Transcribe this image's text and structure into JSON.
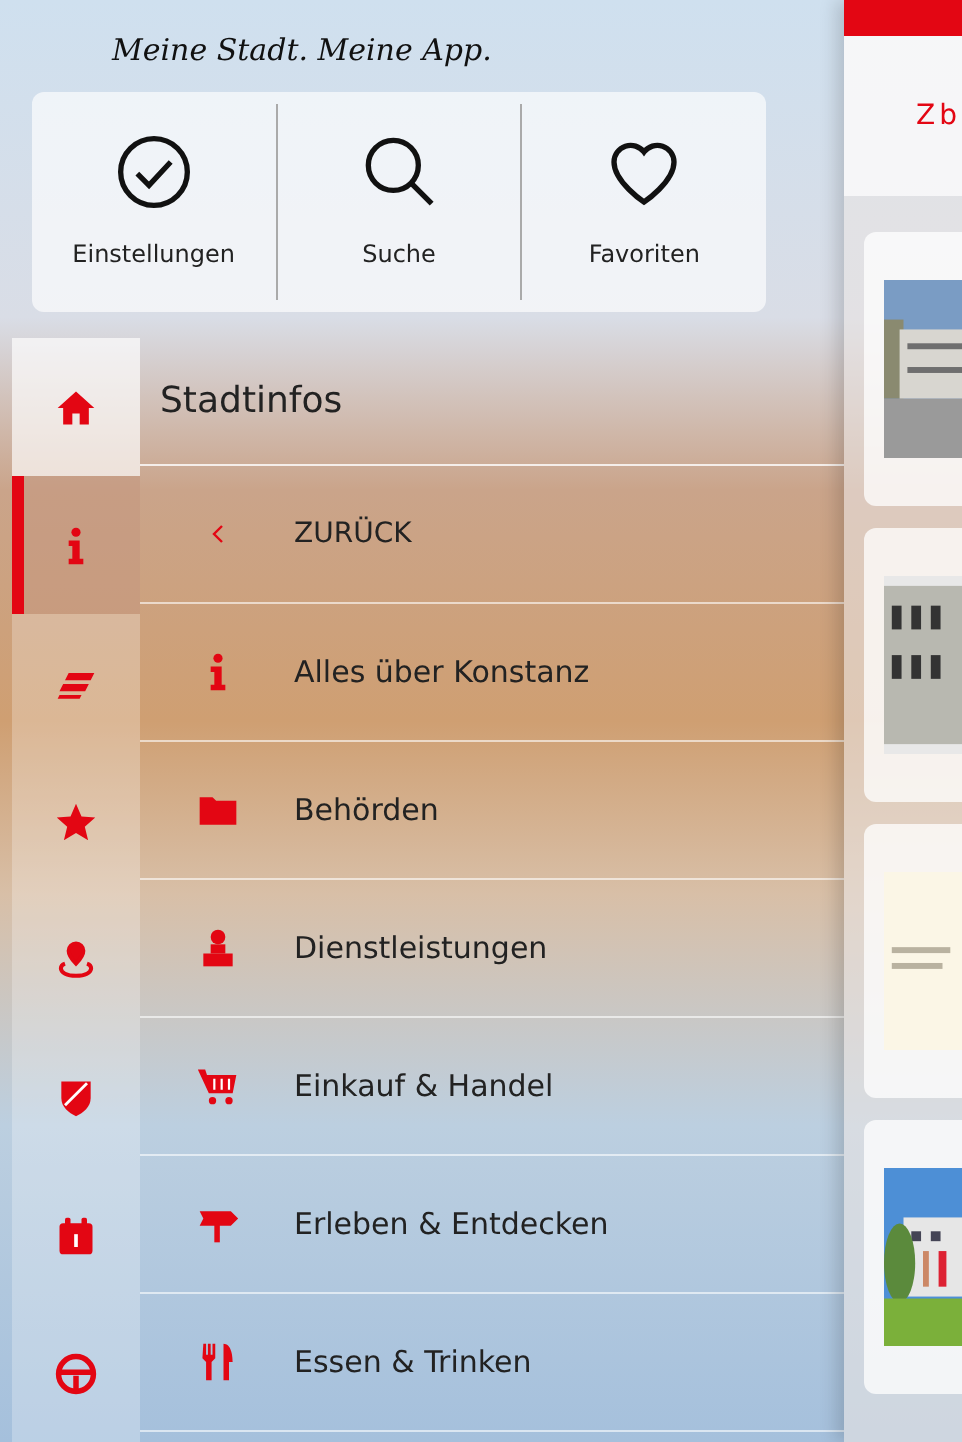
{
  "tagline": "Meine Stadt. Meine App.",
  "quick_actions": [
    {
      "kind": "check",
      "label": "Einstellungen"
    },
    {
      "kind": "search",
      "label": "Suche"
    },
    {
      "kind": "heart",
      "label": "Favoriten"
    }
  ],
  "rail": [
    {
      "kind": "home",
      "selected": false,
      "highlighted": true
    },
    {
      "kind": "info",
      "selected": true,
      "highlighted": false
    },
    {
      "kind": "s-logo",
      "selected": false,
      "highlighted": false
    },
    {
      "kind": "star",
      "selected": false,
      "highlighted": false
    },
    {
      "kind": "pin",
      "selected": false,
      "highlighted": false
    },
    {
      "kind": "shield",
      "selected": false,
      "highlighted": false
    },
    {
      "kind": "calendar",
      "selected": false,
      "highlighted": false
    },
    {
      "kind": "wheel",
      "selected": false,
      "highlighted": false
    }
  ],
  "menu": {
    "title": "Stadtinfos",
    "items": [
      {
        "kind": "back",
        "label": "ZURÜCK"
      },
      {
        "kind": "info",
        "label": "Alles über Konstanz"
      },
      {
        "kind": "folder",
        "label": "Behörden"
      },
      {
        "kind": "person",
        "label": "Dienstleistungen"
      },
      {
        "kind": "cart",
        "label": "Einkauf & Handel"
      },
      {
        "kind": "sign",
        "label": "Erleben & Entdecken"
      },
      {
        "kind": "cutlery",
        "label": "Essen & Trinken"
      }
    ]
  },
  "content": {
    "heading": "Zb"
  }
}
